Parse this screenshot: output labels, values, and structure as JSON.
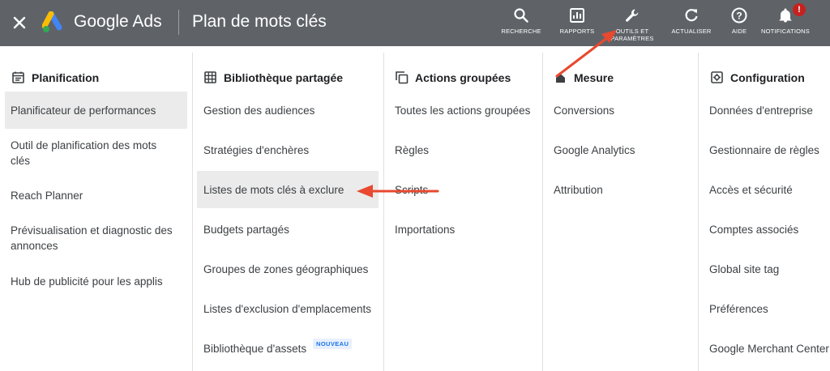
{
  "header": {
    "brand": "Google Ads",
    "page_title": "Plan de mots clés",
    "background_color": "#5f6368",
    "tools": [
      {
        "label": "RECHERCHE",
        "icon": "search-icon"
      },
      {
        "label": "RAPPORTS",
        "icon": "reports-icon"
      },
      {
        "label_line1": "OUTILS ET",
        "label_line2": "PARAMÈTRES",
        "icon": "wrench-icon"
      },
      {
        "label": "ACTUALISER",
        "icon": "refresh-icon"
      },
      {
        "label": "AIDE",
        "icon": "help-icon"
      },
      {
        "label": "NOTIFICATIONS",
        "icon": "bell-icon",
        "badge": "!"
      }
    ]
  },
  "columns": {
    "planification": {
      "title": "Planification",
      "icon": "calendar-icon",
      "items": [
        {
          "label": "Planificateur de performances",
          "selected": true
        },
        {
          "line1": "Outil de planification des mots",
          "line2": "clés"
        },
        {
          "label": "Reach Planner"
        },
        {
          "line1": "Prévisualisation et diagnostic des",
          "line2": "annonces"
        },
        {
          "label": "Hub de publicité pour les applis"
        }
      ]
    },
    "bibliotheque": {
      "title": "Bibliothèque partagée",
      "icon": "grid-icon",
      "items": [
        {
          "label": "Gestion des audiences"
        },
        {
          "label": "Stratégies d'enchères"
        },
        {
          "label": "Listes de mots clés à exclure",
          "selected": true
        },
        {
          "label": "Budgets partagés"
        },
        {
          "label": "Groupes de zones géographiques"
        },
        {
          "label": "Listes d'exclusion d'emplacements"
        },
        {
          "label": "Bibliothèque d'assets",
          "badge": "NOUVEAU"
        }
      ]
    },
    "actions": {
      "title": "Actions groupées",
      "icon": "copy-icon",
      "items": [
        {
          "label": "Toutes les actions groupées"
        },
        {
          "label": "Règles"
        },
        {
          "label": "Scripts"
        },
        {
          "label": "Importations"
        }
      ]
    },
    "mesure": {
      "title": "Mesure",
      "icon": "measure-icon",
      "items": [
        {
          "label": "Conversions"
        },
        {
          "label": "Google Analytics"
        },
        {
          "label": "Attribution"
        }
      ]
    },
    "configuration": {
      "title": "Configuration",
      "icon": "settings-icon",
      "items": [
        {
          "label": "Données d'entreprise"
        },
        {
          "label": "Gestionnaire de règles"
        },
        {
          "label": "Accès et sécurité"
        },
        {
          "label": "Comptes associés"
        },
        {
          "label": "Global site tag"
        },
        {
          "label": "Préférences"
        },
        {
          "label": "Google Merchant Center"
        }
      ]
    }
  },
  "annotations": {
    "arrow_color": "#e8492f"
  }
}
